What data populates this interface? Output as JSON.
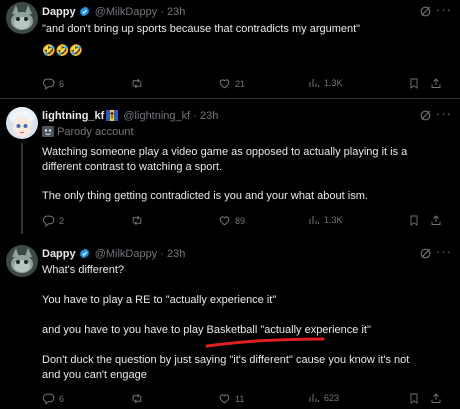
{
  "tweets": [
    {
      "name": "Dappy",
      "handle": "@MilkDappy",
      "time": "23h",
      "lines": [
        "\"and don't bring up sports because that contradicts my argument\"",
        "🤣🤣🤣"
      ],
      "stats": {
        "replies": "6",
        "retweets": "",
        "likes": "21",
        "views": "1.3K"
      }
    },
    {
      "name": "lightning_kf",
      "handle": "@lightning_kf",
      "time": "23h",
      "parody_label": "Parody account",
      "lines": [
        "Watching someone play a video game as opposed to actually playing it is a",
        "different contrast to watching a sport.",
        "The only thing getting contradicted is you and your what about ism."
      ],
      "stats": {
        "replies": "2",
        "retweets": "",
        "likes": "89",
        "views": "1.3K"
      }
    },
    {
      "name": "Dappy",
      "handle": "@MilkDappy",
      "time": "23h",
      "lines": [
        "What's different?",
        "You have to play a RE to \"actually experience it\"",
        "and you have to you have to play Basketball \"actually experience it\"",
        "Don't duck the question by just saying \"it's different\" cause you know it's not",
        "and you can't engage"
      ],
      "stats": {
        "replies": "6",
        "retweets": "",
        "likes": "11",
        "views": "623"
      }
    }
  ],
  "separator": "·",
  "colors": {
    "background": "#000000",
    "text": "#e7e9ea",
    "muted": "#71767b",
    "verified": "#1d9bf0",
    "divider": "#2f3336",
    "annotation": "#e0201f"
  },
  "icons": [
    "verified-badge-icon",
    "grok-icon",
    "more-icon",
    "reply-icon",
    "retweet-icon",
    "like-icon",
    "views-icon",
    "bookmark-icon",
    "share-icon",
    "parody-mask-icon",
    "flag-icon"
  ]
}
